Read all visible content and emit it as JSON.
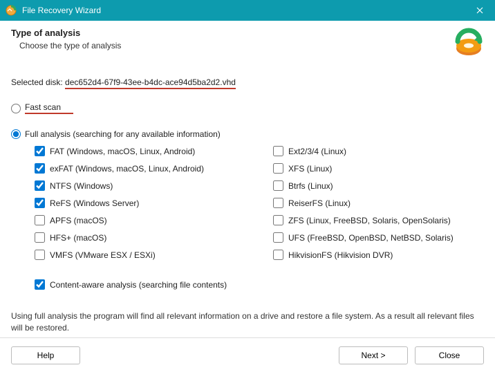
{
  "window": {
    "title": "File Recovery Wizard"
  },
  "header": {
    "title": "Type of analysis",
    "subtitle": "Choose the type of analysis"
  },
  "selected_disk": {
    "label": "Selected disk: ",
    "value": "dec652d4-67f9-43ee-b4dc-ace94d5ba2d2.vhd"
  },
  "options": {
    "fast_scan": {
      "label": "Fast scan",
      "checked": false
    },
    "full_analysis": {
      "label": "Full analysis (searching for any available information)",
      "checked": true
    },
    "content_aware": {
      "label": "Content-aware analysis (searching file contents)",
      "checked": true
    }
  },
  "filesystems": {
    "left": [
      {
        "label": "FAT (Windows, macOS, Linux, Android)",
        "checked": true
      },
      {
        "label": "exFAT (Windows, macOS, Linux, Android)",
        "checked": true
      },
      {
        "label": "NTFS (Windows)",
        "checked": true
      },
      {
        "label": "ReFS (Windows Server)",
        "checked": true
      },
      {
        "label": "APFS (macOS)",
        "checked": false
      },
      {
        "label": "HFS+ (macOS)",
        "checked": false
      },
      {
        "label": "VMFS (VMware ESX / ESXi)",
        "checked": false
      }
    ],
    "right": [
      {
        "label": "Ext2/3/4 (Linux)",
        "checked": false
      },
      {
        "label": "XFS (Linux)",
        "checked": false
      },
      {
        "label": "Btrfs (Linux)",
        "checked": false
      },
      {
        "label": "ReiserFS (Linux)",
        "checked": false
      },
      {
        "label": "ZFS (Linux, FreeBSD, Solaris, OpenSolaris)",
        "checked": false
      },
      {
        "label": "UFS (FreeBSD, OpenBSD, NetBSD, Solaris)",
        "checked": false
      },
      {
        "label": "HikvisionFS (Hikvision DVR)",
        "checked": false
      }
    ]
  },
  "note": "Using full analysis the program will find all relevant information on a drive and restore a file system. As a result all relevant files will be restored.",
  "buttons": {
    "help": "Help",
    "next": "Next >",
    "close": "Close"
  }
}
